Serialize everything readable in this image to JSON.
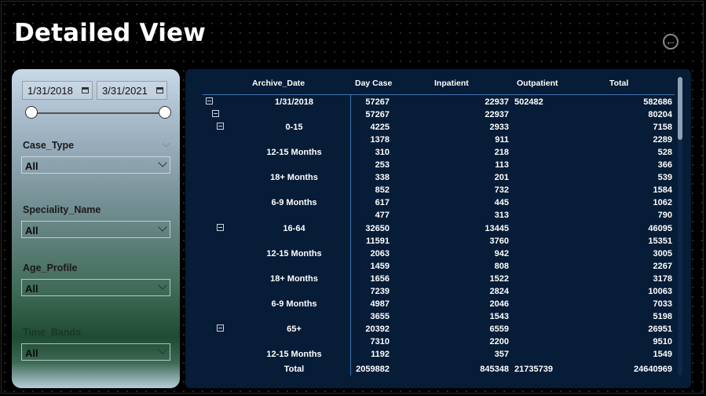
{
  "page": {
    "title": "Detailed View"
  },
  "filters": {
    "date_start": "1/31/2018",
    "date_end": "3/31/2021",
    "case_type": {
      "label": "Case_Type",
      "value": "All"
    },
    "speciality": {
      "label": "Speciality_Name",
      "value": "All"
    },
    "age_profile": {
      "label": "Age_Profile",
      "value": "All"
    },
    "time_bands": {
      "label": "Time_Bands",
      "value": "All"
    }
  },
  "table": {
    "headers": {
      "date": "Archive_Date",
      "day": "Day Case",
      "inpatient": "Inpatient",
      "outpatient": "Outpatient",
      "total": "Total"
    },
    "rows": [
      {
        "expand_level": 0,
        "label": "1/31/2018",
        "day": "57267",
        "inpatient": "22937",
        "outpatient": "502482",
        "total": "582686"
      },
      {
        "expand_level": 1,
        "label": "",
        "day": "57267",
        "inpatient": "22937",
        "outpatient": "",
        "total": "80204"
      },
      {
        "expand_level": 2,
        "label": "0-15",
        "day": "4225",
        "inpatient": "2933",
        "outpatient": "",
        "total": "7158"
      },
      {
        "expand_level": -1,
        "label": "",
        "day": "1378",
        "inpatient": "911",
        "outpatient": "",
        "total": "2289"
      },
      {
        "expand_level": -1,
        "label": "12-15 Months",
        "day": "310",
        "inpatient": "218",
        "outpatient": "",
        "total": "528"
      },
      {
        "expand_level": -1,
        "label": "",
        "day": "253",
        "inpatient": "113",
        "outpatient": "",
        "total": "366"
      },
      {
        "expand_level": -1,
        "label": "18+ Months",
        "day": "338",
        "inpatient": "201",
        "outpatient": "",
        "total": "539"
      },
      {
        "expand_level": -1,
        "label": "",
        "day": "852",
        "inpatient": "732",
        "outpatient": "",
        "total": "1584"
      },
      {
        "expand_level": -1,
        "label": "6-9 Months",
        "day": "617",
        "inpatient": "445",
        "outpatient": "",
        "total": "1062"
      },
      {
        "expand_level": -1,
        "label": "",
        "day": "477",
        "inpatient": "313",
        "outpatient": "",
        "total": "790"
      },
      {
        "expand_level": 2,
        "label": "16-64",
        "day": "32650",
        "inpatient": "13445",
        "outpatient": "",
        "total": "46095"
      },
      {
        "expand_level": -1,
        "label": "",
        "day": "11591",
        "inpatient": "3760",
        "outpatient": "",
        "total": "15351"
      },
      {
        "expand_level": -1,
        "label": "12-15 Months",
        "day": "2063",
        "inpatient": "942",
        "outpatient": "",
        "total": "3005"
      },
      {
        "expand_level": -1,
        "label": "",
        "day": "1459",
        "inpatient": "808",
        "outpatient": "",
        "total": "2267"
      },
      {
        "expand_level": -1,
        "label": "18+ Months",
        "day": "1656",
        "inpatient": "1522",
        "outpatient": "",
        "total": "3178"
      },
      {
        "expand_level": -1,
        "label": "",
        "day": "7239",
        "inpatient": "2824",
        "outpatient": "",
        "total": "10063"
      },
      {
        "expand_level": -1,
        "label": "6-9 Months",
        "day": "4987",
        "inpatient": "2046",
        "outpatient": "",
        "total": "7033"
      },
      {
        "expand_level": -1,
        "label": "",
        "day": "3655",
        "inpatient": "1543",
        "outpatient": "",
        "total": "5198"
      },
      {
        "expand_level": 2,
        "label": "65+",
        "day": "20392",
        "inpatient": "6559",
        "outpatient": "",
        "total": "26951"
      },
      {
        "expand_level": -1,
        "label": "",
        "day": "7310",
        "inpatient": "2200",
        "outpatient": "",
        "total": "9510"
      },
      {
        "expand_level": -1,
        "label": "12-15 Months",
        "day": "1192",
        "inpatient": "357",
        "outpatient": "",
        "total": "1549"
      }
    ],
    "total_row": {
      "label": "Total",
      "day": "2059882",
      "inpatient": "845348",
      "outpatient": "21735739",
      "total": "24640969"
    }
  }
}
